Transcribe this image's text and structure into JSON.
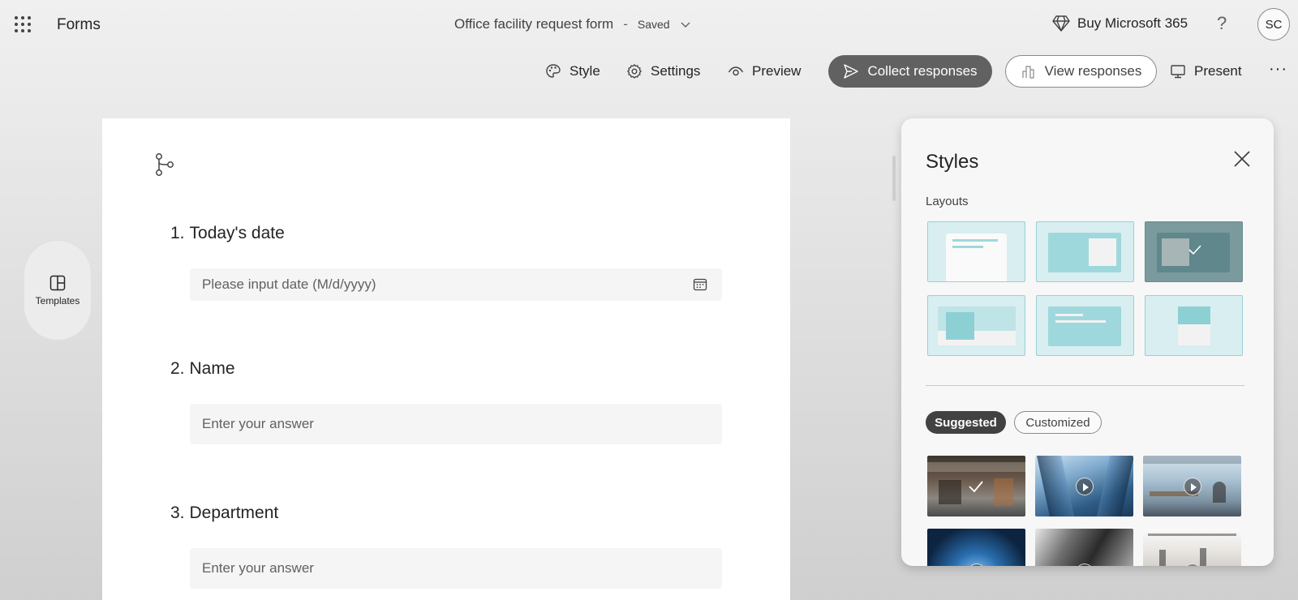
{
  "header": {
    "app_name": "Forms",
    "form_title": "Office facility request form",
    "separator": "-",
    "save_status": "Saved",
    "buy_label": "Buy Microsoft 365",
    "help_label": "?",
    "avatar_initials": "SC"
  },
  "toolbar": {
    "style_label": "Style",
    "settings_label": "Settings",
    "preview_label": "Preview",
    "collect_label": "Collect responses",
    "view_label": "View responses",
    "present_label": "Present",
    "more_label": "···"
  },
  "sidebar": {
    "templates_label": "Templates"
  },
  "form": {
    "questions": [
      {
        "number": "1.",
        "title": "Today's date",
        "placeholder": "Please input date (M/d/yyyy)"
      },
      {
        "number": "2.",
        "title": "Name",
        "placeholder": "Enter your answer"
      },
      {
        "number": "3.",
        "title": "Department",
        "placeholder": "Enter your answer"
      }
    ]
  },
  "styles_panel": {
    "title": "Styles",
    "layouts_label": "Layouts",
    "selected_layout": 3,
    "tabs": [
      {
        "label": "Suggested",
        "active": true
      },
      {
        "label": "Customized",
        "active": false
      }
    ]
  },
  "colors": {
    "primary_button": "#616161",
    "layout_teal": "#9fd8dc",
    "layout_bg": "#d8eef0",
    "panel_bg": "#f7f7f7"
  }
}
